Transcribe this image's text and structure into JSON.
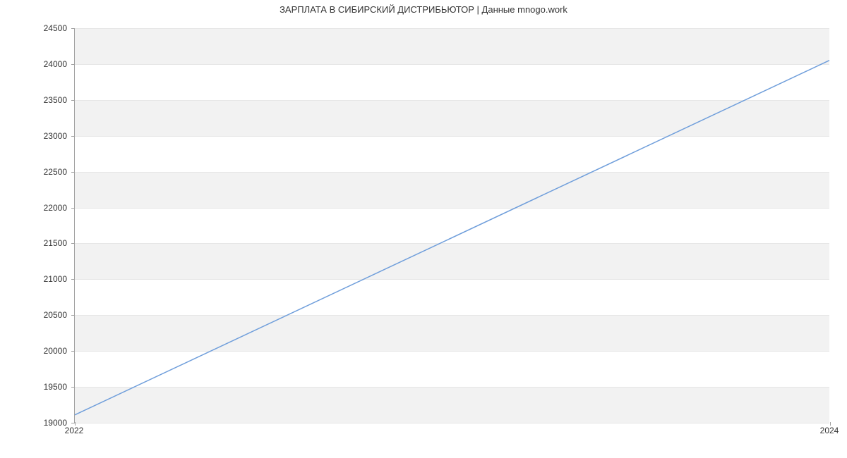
{
  "chart_data": {
    "type": "line",
    "title": "ЗАРПЛАТА В СИБИРСКИЙ ДИСТРИБЬЮТОР | Данные mnogo.work",
    "xlabel": "",
    "ylabel": "",
    "x": [
      2022,
      2024
    ],
    "values": [
      19100,
      24050
    ],
    "xlim": [
      2022,
      2024
    ],
    "ylim": [
      19000,
      24500
    ],
    "yticks": [
      19000,
      19500,
      20000,
      20500,
      21000,
      21500,
      22000,
      22500,
      23000,
      23500,
      24000,
      24500
    ],
    "xticks": [
      2022,
      2024
    ],
    "line_color": "#6f9edb",
    "band_color": "#f2f2f2",
    "grid": true
  }
}
